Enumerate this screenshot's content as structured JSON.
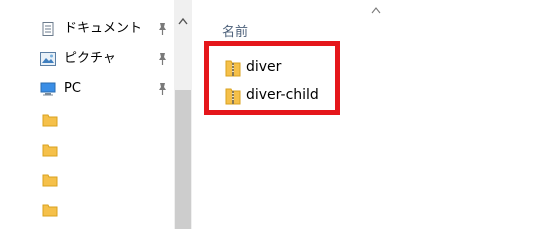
{
  "nav": {
    "items": [
      {
        "label": "ドキュメント",
        "icon": "documents-icon",
        "pinned": true
      },
      {
        "label": "ピクチャ",
        "icon": "pictures-icon",
        "pinned": true
      },
      {
        "label": "PC",
        "icon": "pc-icon",
        "pinned": true
      }
    ],
    "folders": [
      "folder-icon",
      "folder-icon",
      "folder-icon",
      "folder-icon"
    ]
  },
  "file_list": {
    "column_name": "名前",
    "sort": "ascending",
    "files": [
      {
        "name": "diver",
        "icon": "zip-folder-icon"
      },
      {
        "name": "diver-child",
        "icon": "zip-folder-icon"
      }
    ]
  },
  "colors": {
    "highlight": "#e5161b",
    "folder": "#f5c04a",
    "header_text": "#4c607a"
  }
}
